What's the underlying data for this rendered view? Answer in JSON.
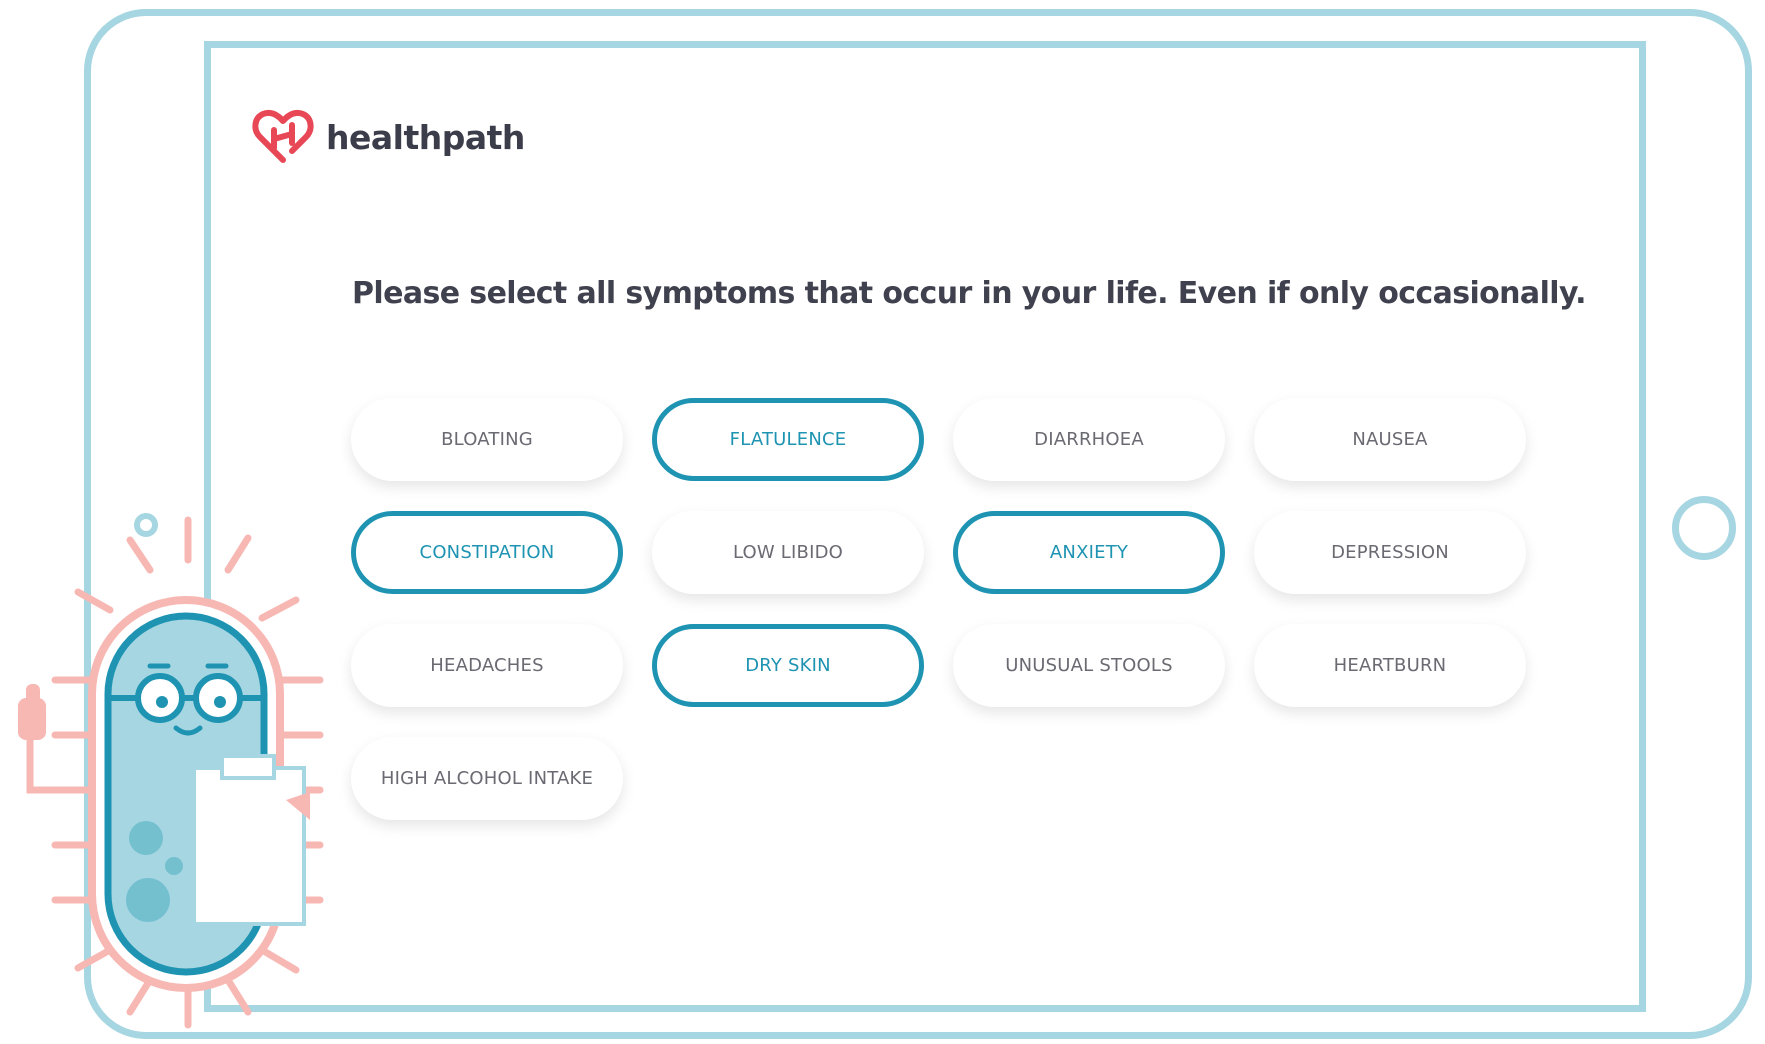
{
  "brand": {
    "name": "healthpath",
    "logo_icon": "heart-h-icon",
    "logo_color": "#e84856"
  },
  "question": "Please select all symptoms that occur in your life. Even if only occasionally.",
  "symptoms": [
    {
      "label": "BLOATING",
      "selected": false
    },
    {
      "label": "FLATULENCE",
      "selected": true
    },
    {
      "label": "DIARRHOEA",
      "selected": false
    },
    {
      "label": "NAUSEA",
      "selected": false
    },
    {
      "label": "CONSTIPATION",
      "selected": true
    },
    {
      "label": "LOW LIBIDO",
      "selected": false
    },
    {
      "label": "ANXIETY",
      "selected": true
    },
    {
      "label": "DEPRESSION",
      "selected": false
    },
    {
      "label": "HEADACHES",
      "selected": false
    },
    {
      "label": "DRY SKIN",
      "selected": true
    },
    {
      "label": "UNUSUAL STOOLS",
      "selected": false
    },
    {
      "label": "HEARTBURN",
      "selected": false
    },
    {
      "label": "HIGH ALCOHOL INTAKE",
      "selected": false
    }
  ],
  "colors": {
    "frame": "#a6d6e1",
    "accent": "#1e94b2",
    "text": "#40414e",
    "mascot_body": "#a6d6e1",
    "mascot_outline": "#f7b8b3"
  }
}
